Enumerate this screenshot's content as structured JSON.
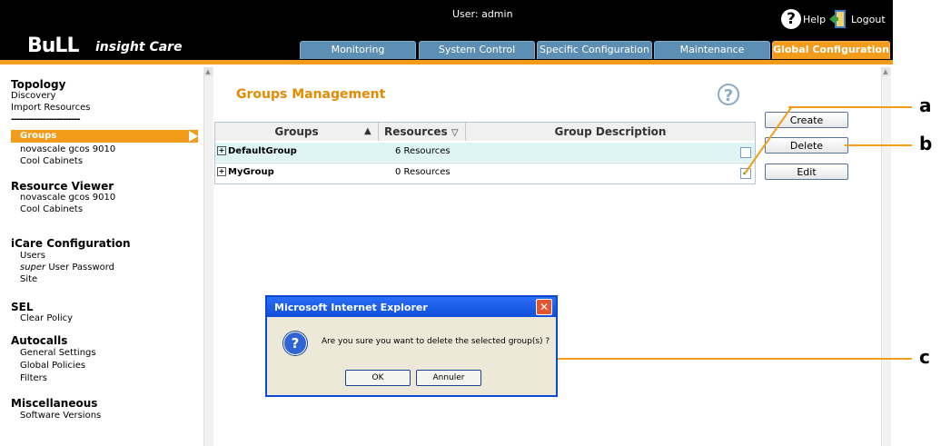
{
  "header": {
    "logo": "BuLL",
    "brand": "insight Care",
    "user": "User: admin",
    "help_label": "Help",
    "logout_label": "Logout",
    "help_glyph": "?"
  },
  "tabs": [
    {
      "label": "Monitoring",
      "active": false
    },
    {
      "label": "System Control",
      "active": false
    },
    {
      "label": "Specific Configuration",
      "active": false
    },
    {
      "label": "Maintenance",
      "active": false
    },
    {
      "label": "Global Configuration",
      "active": true
    }
  ],
  "sidebar": {
    "topology": {
      "title": "Topology",
      "items": [
        "Discovery",
        "Import Resources"
      ],
      "separator": "------------------------"
    },
    "topology_sub": {
      "selected": "Groups",
      "items": [
        "novascale gcos 9010",
        "Cool Cabinets"
      ]
    },
    "resource_viewer": {
      "title": "Resource Viewer",
      "items": [
        "novascale gcos 9010",
        "Cool Cabinets"
      ]
    },
    "icare": {
      "title": "iCare Configuration",
      "users": "Users",
      "super": "super",
      "user_password": " User Password",
      "site": "Site"
    },
    "sel": {
      "title": "SEL",
      "items": [
        "Clear Policy"
      ]
    },
    "autocalls": {
      "title": "Autocalls",
      "items": [
        "General Settings",
        "Global Policies",
        "Filters"
      ]
    },
    "misc": {
      "title": "Miscellaneous",
      "items": [
        "Software Versions"
      ]
    }
  },
  "main": {
    "title": "Groups Management",
    "help_glyph": "?",
    "table": {
      "columns": [
        "Groups",
        "Resources",
        "Group Description"
      ],
      "sort_asc": "▲",
      "sort_desc": "▽",
      "rows": [
        {
          "expander": "+",
          "group": "DefaultGroup",
          "resources": "6 Resources",
          "description": "",
          "checked": false
        },
        {
          "expander": "+",
          "group": "MyGroup",
          "resources": "0 Resources",
          "description": "",
          "checked": true
        }
      ]
    },
    "buttons": {
      "create": "Create",
      "delete": "Delete",
      "edit": "Edit"
    }
  },
  "dialog": {
    "title": "Microsoft Internet Explorer",
    "close": "✕",
    "icon": "?",
    "message": "Are you sure you want to delete the selected group(s) ?",
    "ok": "OK",
    "cancel": "Annuler"
  },
  "callouts": {
    "a": "a",
    "b": "b",
    "c": "c"
  },
  "colors": {
    "accent": "#f39c1c",
    "tab": "#5d8fb4",
    "title": "#e68a00",
    "row_alt": "#dff5f5"
  }
}
